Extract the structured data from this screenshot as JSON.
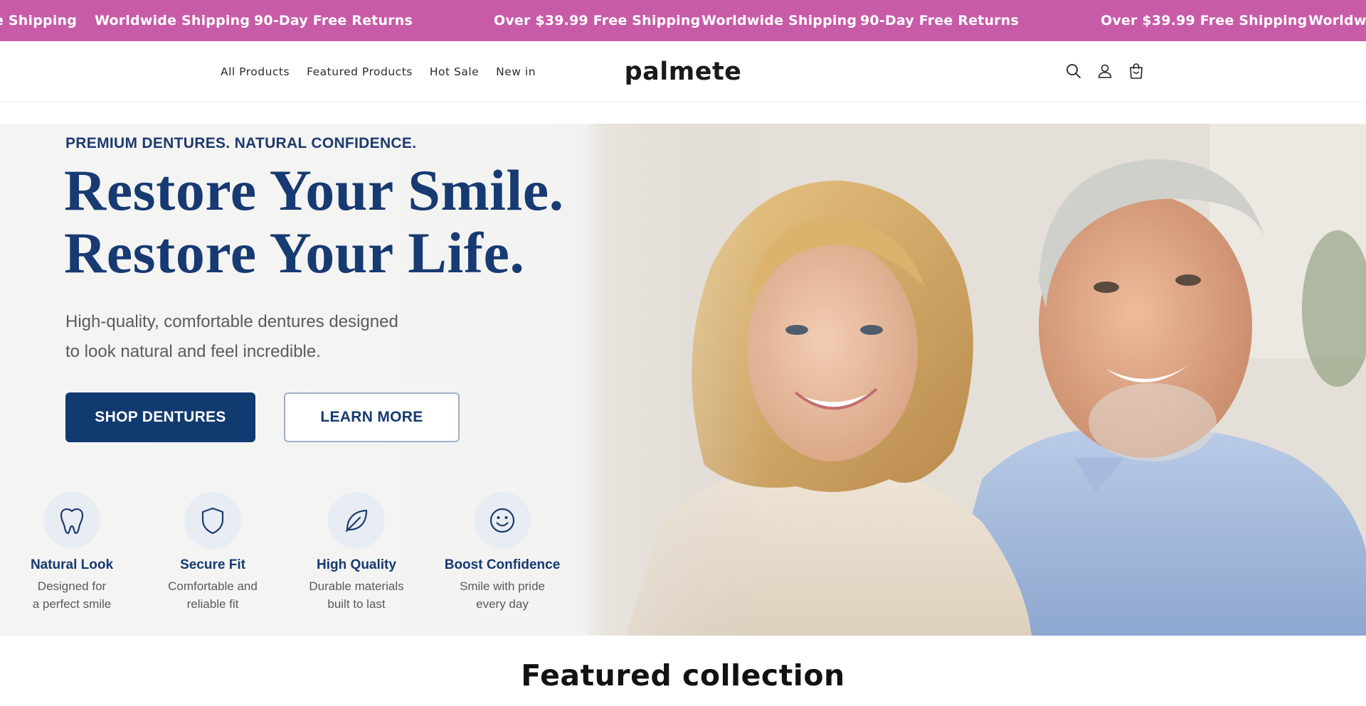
{
  "announcement": {
    "items": [
      "e Shipping",
      "Worldwide Shipping",
      "90-Day Free Returns",
      "Over $39.99 Free Shipping",
      "Worldwide Shipping",
      "90-Day Free Returns",
      "Over $39.99 Free Shipping",
      "Worldwid"
    ],
    "background": "#c85ba8"
  },
  "header": {
    "nav": [
      "All Products",
      "Featured Products",
      "Hot Sale",
      "New in"
    ],
    "logo": "palmete",
    "icons": [
      "search-icon",
      "account-icon",
      "cart-icon"
    ]
  },
  "hero": {
    "eyebrow": "PREMIUM DENTURES. NATURAL CONFIDENCE.",
    "headline": [
      "Restore Your Smile.",
      "Restore Your Life."
    ],
    "subtext": [
      "High-quality, comfortable dentures designed",
      "to look natural and feel incredible."
    ],
    "primary_button": "SHOP DENTURES",
    "secondary_button": "LEARN MORE",
    "features": [
      {
        "icon": "tooth-icon",
        "title": "Natural Look",
        "lines": [
          "Designed for",
          "a perfect smile"
        ]
      },
      {
        "icon": "shield-icon",
        "title": "Secure Fit",
        "lines": [
          "Comfortable and",
          "reliable fit"
        ]
      },
      {
        "icon": "leaf-icon",
        "title": "High Quality",
        "lines": [
          "Durable materials",
          "built to last"
        ]
      },
      {
        "icon": "smile-icon",
        "title": "Boost Confidence",
        "lines": [
          "Smile with pride",
          "every day"
        ]
      }
    ],
    "accent_color": "#113a70"
  },
  "featured": {
    "title": "Featured collection"
  }
}
